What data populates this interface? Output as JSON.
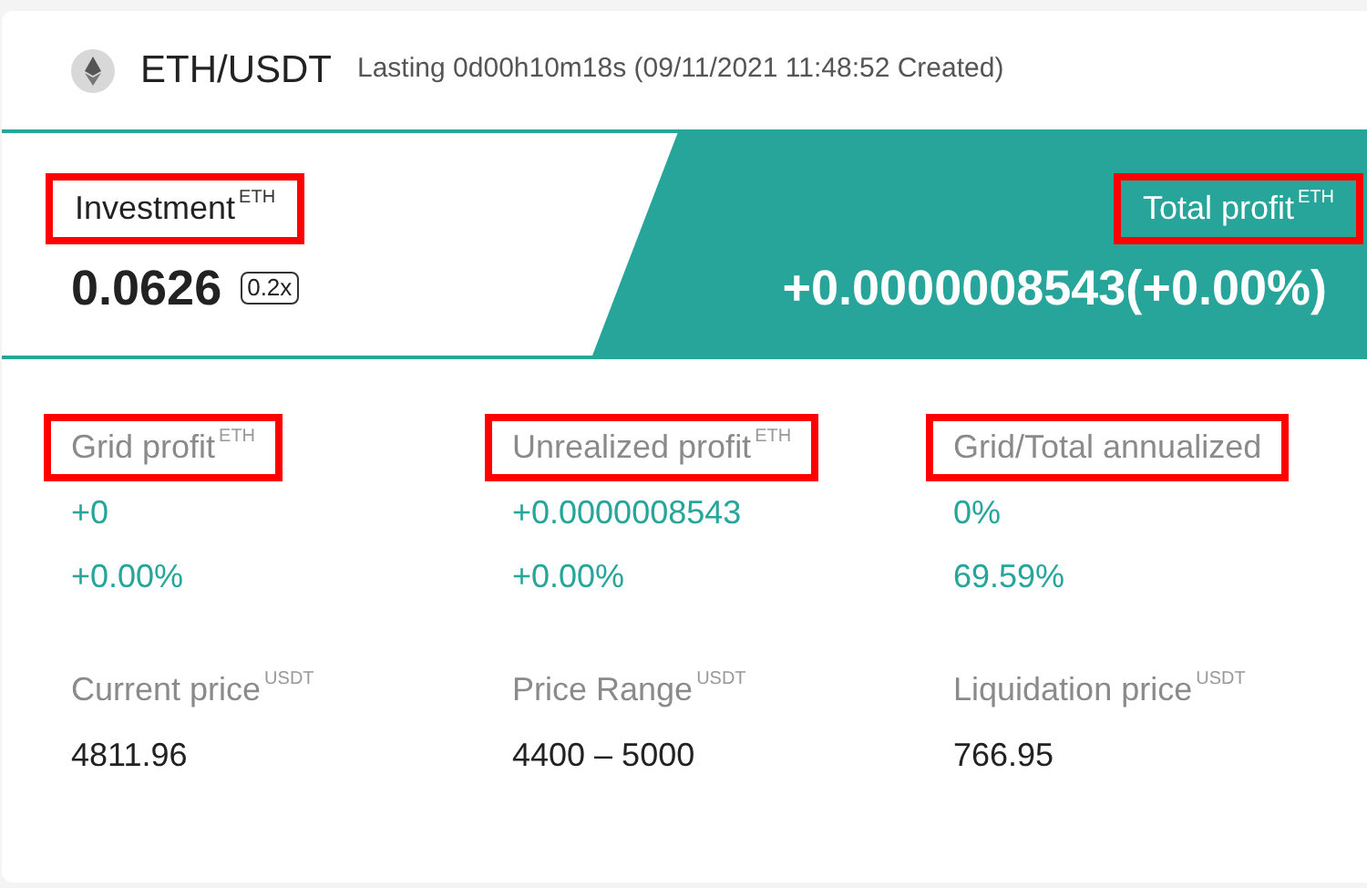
{
  "header": {
    "pair": "ETH/USDT",
    "duration": "Lasting 0d00h10m18s (09/11/2021 11:48:52 Created)"
  },
  "investment": {
    "label": "Investment",
    "unit": "ETH",
    "value": "0.0626",
    "leverage": "0.2x",
    "highlighted": true
  },
  "total_profit": {
    "label": "Total profit",
    "unit": "ETH",
    "value": "+0.0000008543(+0.00%)",
    "highlighted": true
  },
  "stats": [
    {
      "label": "Grid profit",
      "unit": "ETH",
      "highlighted": true,
      "values": [
        "+0",
        "+0.00%"
      ],
      "kind": "profit"
    },
    {
      "label": "Unrealized profit",
      "unit": "ETH",
      "highlighted": true,
      "values": [
        "+0.0000008543",
        "+0.00%"
      ],
      "kind": "profit"
    },
    {
      "label": "Grid/Total annualized",
      "highlighted": true,
      "values": [
        "0%",
        "69.59%"
      ],
      "kind": "profit"
    },
    {
      "label": "Current price",
      "unit": "USDT",
      "highlighted": false,
      "values": [
        "4811.96"
      ],
      "kind": "price"
    },
    {
      "label": "Price Range",
      "unit": "USDT",
      "highlighted": false,
      "values": [
        "4400 – 5000"
      ],
      "kind": "price"
    },
    {
      "label": "Liquidation price",
      "unit": "USDT",
      "highlighted": false,
      "values": [
        "766.95"
      ],
      "kind": "price"
    }
  ]
}
